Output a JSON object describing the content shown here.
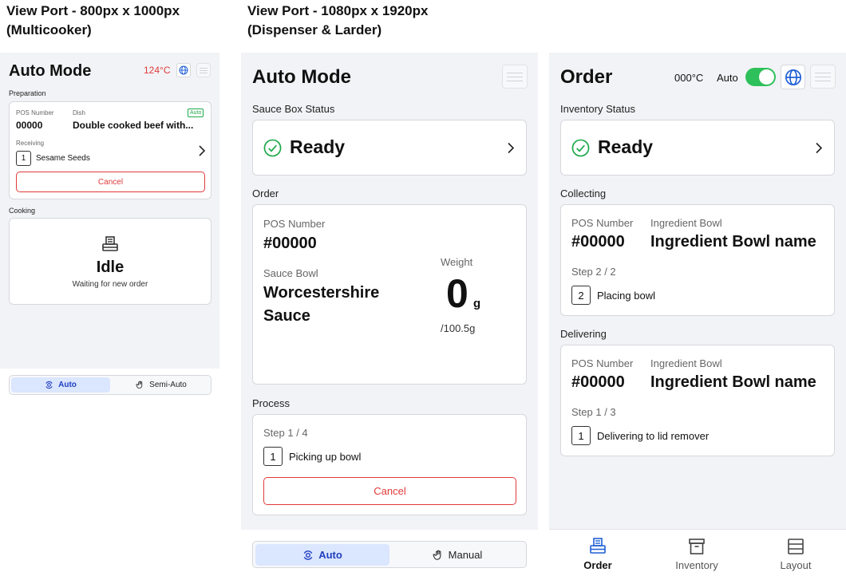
{
  "labels": {
    "multicooker_line1": "View Port - 800px x 1000px",
    "multicooker_line2": "(Multicooker)",
    "dispenser_line1": "View Port - 1080px x 1920px",
    "dispenser_line2": "(Dispenser & Larder)"
  },
  "multicooker": {
    "title": "Auto Mode",
    "temperature": "124°C",
    "preparation_label": "Preparation",
    "pos_label": "POS Number",
    "pos_value": "00000",
    "dish_label": "Dish",
    "dish_value": "Double cooked beef with...",
    "auto_badge": "Auto",
    "receiving_label": "Receiving",
    "receiving_qty": "1",
    "receiving_item": "Sesame Seeds",
    "cancel_label": "Cancel",
    "cooking_label": "Cooking",
    "idle_title": "Idle",
    "idle_sub": "Waiting for new order",
    "seg_auto": "Auto",
    "seg_semi": "Semi-Auto"
  },
  "dispenser": {
    "title": "Auto Mode",
    "sauce_status_label": "Sauce Box Status",
    "ready_text": "Ready",
    "order_label": "Order",
    "pos_label": "POS Number",
    "pos_value": "#00000",
    "sauce_bowl_label": "Sauce Bowl",
    "sauce_line1": "Worcestershire",
    "sauce_line2": "Sauce",
    "weight_label": "Weight",
    "weight_value": "0",
    "weight_unit": "g",
    "weight_total": "/100.5g",
    "process_label": "Process",
    "step_text": "Step 1 / 4",
    "step_qty": "1",
    "step_action": "Picking up bowl",
    "cancel_label": "Cancel",
    "seg_auto": "Auto",
    "seg_manual": "Manual"
  },
  "larder": {
    "title": "Order",
    "temperature": "000°C",
    "auto_label": "Auto",
    "toggle_on": true,
    "inventory_label": "Inventory Status",
    "ready_text": "Ready",
    "collecting_label": "Collecting",
    "collecting": {
      "pos_label": "POS Number",
      "pos_value": "#00000",
      "bowl_label": "Ingredient Bowl",
      "bowl_value": "Ingredient Bowl name",
      "step_text": "Step 2 / 2",
      "qty": "2",
      "action": "Placing bowl"
    },
    "delivering_label": "Delivering",
    "delivering": {
      "pos_label": "POS Number",
      "pos_value": "#00000",
      "bowl_label": "Ingredient Bowl",
      "bowl_value": "Ingredient Bowl name",
      "step_text": "Step 1 / 3",
      "qty": "1",
      "action": "Delivering to lid remover"
    },
    "nav": [
      {
        "label": "Order",
        "icon": "order-icon"
      },
      {
        "label": "Inventory",
        "icon": "inventory-icon"
      },
      {
        "label": "Layout",
        "icon": "layout-icon"
      }
    ]
  },
  "colors": {
    "accent_blue": "#1f3fbf",
    "ready_green": "#1faa4c",
    "cancel_red": "#e03a3a",
    "temp_red": "#e03a3a",
    "toggle_green": "#2ec05a"
  }
}
